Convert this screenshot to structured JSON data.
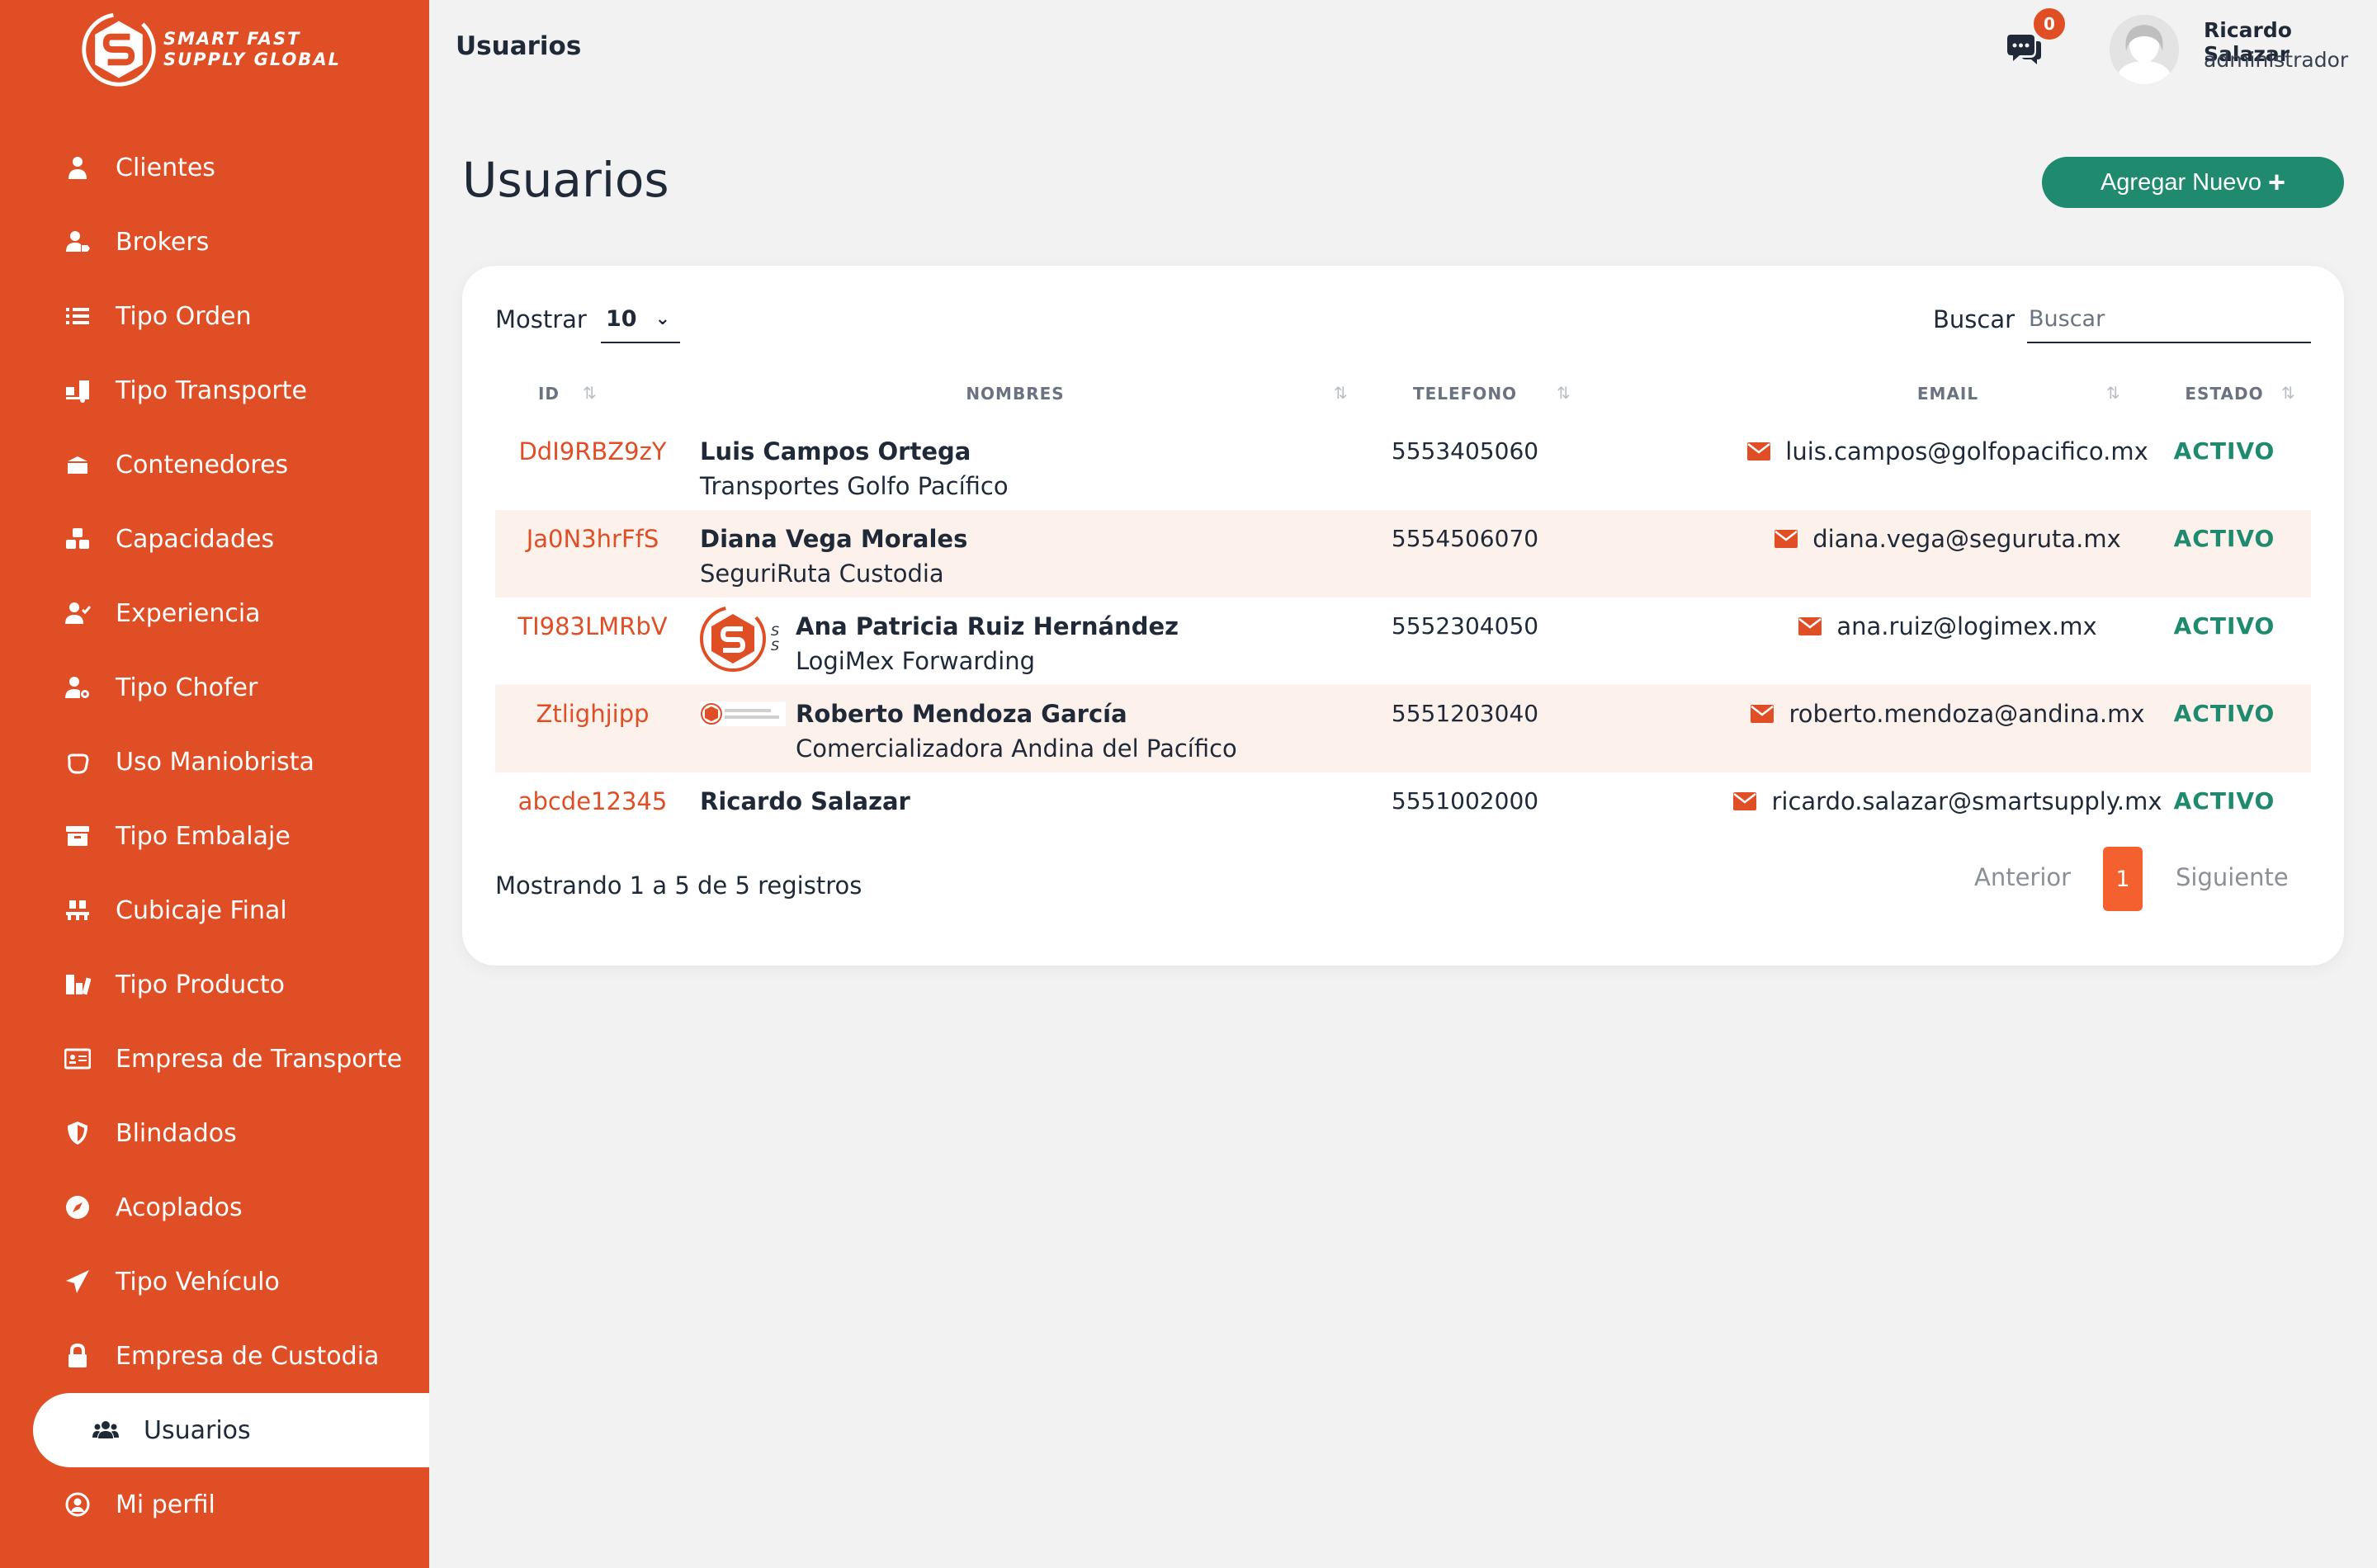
{
  "brand": {
    "name_line1": "SMART FAST",
    "name_line2": "SUPPLY GLOBAL",
    "color": "#e04e25",
    "accent": "#1f8a6e"
  },
  "sidebar": {
    "items": [
      {
        "label": "Clientes",
        "icon": "user-icon"
      },
      {
        "label": "Brokers",
        "icon": "user-tag-icon"
      },
      {
        "label": "Tipo Orden",
        "icon": "list-icon"
      },
      {
        "label": "Tipo Transporte",
        "icon": "truck-loading-icon"
      },
      {
        "label": "Contenedores",
        "icon": "box-icon"
      },
      {
        "label": "Capacidades",
        "icon": "cubes-icon"
      },
      {
        "label": "Experiencia",
        "icon": "user-check-icon"
      },
      {
        "label": "Tipo Chofer",
        "icon": "user-cog-icon"
      },
      {
        "label": "Uso Maniobrista",
        "icon": "hand-icon"
      },
      {
        "label": "Tipo Embalaje",
        "icon": "archive-icon"
      },
      {
        "label": "Cubicaje Final",
        "icon": "pallet-icon"
      },
      {
        "label": "Tipo Producto",
        "icon": "products-icon"
      },
      {
        "label": "Empresa de Transporte",
        "icon": "id-card-icon"
      },
      {
        "label": "Blindados",
        "icon": "shield-icon"
      },
      {
        "label": "Acoplados",
        "icon": "compass-icon"
      },
      {
        "label": "Tipo Vehículo",
        "icon": "paper-plane-icon"
      },
      {
        "label": "Empresa de Custodia",
        "icon": "lock-icon"
      },
      {
        "label": "Usuarios",
        "icon": "users-icon"
      },
      {
        "label": "Mi perfil",
        "icon": "user-circle-icon"
      }
    ],
    "active": "Usuarios"
  },
  "topbar": {
    "title": "Usuarios",
    "notifications": "0",
    "user_name": "Ricardo Salazar",
    "user_role": "administrador"
  },
  "page": {
    "title": "Usuarios",
    "add_button": "Agregar Nuevo",
    "add_icon": "plus-icon"
  },
  "table_controls": {
    "show_label": "Mostrar",
    "show_value": "10",
    "search_label": "Buscar",
    "search_placeholder": "Buscar",
    "search_value": ""
  },
  "table": {
    "columns": [
      "ID",
      "NOMBRES",
      "TELEFONO",
      "EMAIL",
      "ESTADO"
    ],
    "rows": [
      {
        "id": "DdI9RBZ9zY",
        "name": "Luis Campos Ortega",
        "company": "Transportes Golfo Pacífico",
        "phone": "5553405060",
        "email": "luis.campos@golfopacifico.mx",
        "status": "ACTIVO",
        "logo": ""
      },
      {
        "id": "Ja0N3hrFfS",
        "name": "Diana Vega Morales",
        "company": "SeguriRuta Custodia",
        "phone": "5554506070",
        "email": "diana.vega@seguruta.mx",
        "status": "ACTIVO",
        "logo": ""
      },
      {
        "id": "TI983LMRbV",
        "name": "Ana Patricia Ruiz Hernández",
        "company": "LogiMex Forwarding",
        "phone": "5552304050",
        "email": "ana.ruiz@logimex.mx",
        "status": "ACTIVO",
        "logo": "large"
      },
      {
        "id": "Ztlighjipp",
        "name": "Roberto Mendoza García",
        "company": "Comercializadora Andina del Pacífico",
        "phone": "5551203040",
        "email": "roberto.mendoza@andina.mx",
        "status": "ACTIVO",
        "logo": "small"
      },
      {
        "id": "abcde12345",
        "name": "Ricardo Salazar",
        "company": "",
        "phone": "5551002000",
        "email": "ricardo.salazar@smartsupply.mx",
        "status": "ACTIVO",
        "logo": ""
      }
    ]
  },
  "pagination": {
    "info": "Mostrando 1 a 5 de 5 registros",
    "prev": "Anterior",
    "current": "1",
    "next": "Siguiente"
  }
}
